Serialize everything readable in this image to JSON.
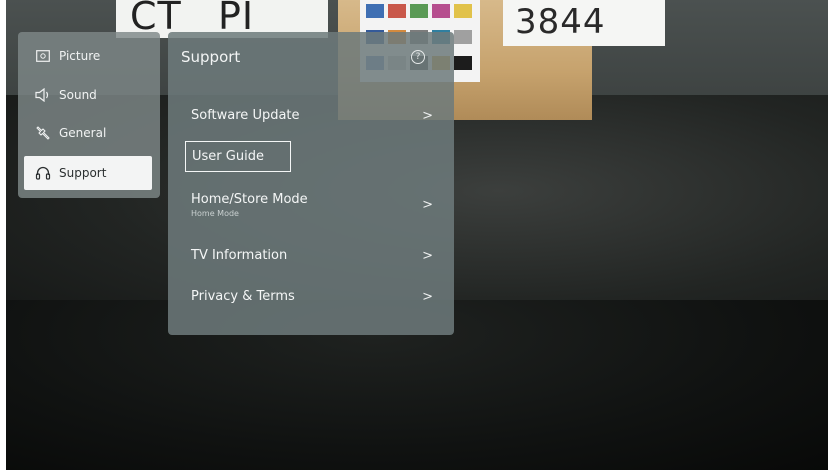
{
  "background": {
    "card_left_a": "CT",
    "card_left_b": "PI",
    "card_right": "3844",
    "swatch_colors": [
      "#3f6fb3",
      "#c9584a",
      "#5a9a55",
      "#b64e8e",
      "#e1c24a",
      "#345a9a",
      "#d48a3e",
      "#7c7c7c",
      "#2f7fa0",
      "#a0a0a0",
      "#6a8fc4",
      "#c4c4c4",
      "#4a4a4a",
      "#d6a43c",
      "#1c1c1c"
    ]
  },
  "categories": [
    {
      "label": "Picture",
      "icon": "picture-icon",
      "selected": false
    },
    {
      "label": "Sound",
      "icon": "speaker-icon",
      "selected": false
    },
    {
      "label": "General",
      "icon": "wrench-icon",
      "selected": false
    },
    {
      "label": "Support",
      "icon": "headset-icon",
      "selected": true
    }
  ],
  "panel": {
    "title": "Support",
    "help_icon_glyph": "?",
    "items": [
      {
        "label": "Software Update",
        "sub": "",
        "chevron": ">"
      },
      {
        "label": "User Guide",
        "sub": "",
        "chevron": ""
      },
      {
        "label": "Home/Store Mode",
        "sub": "Home Mode",
        "chevron": ">"
      },
      {
        "label": "TV Information",
        "sub": "",
        "chevron": ">"
      },
      {
        "label": "Privacy & Terms",
        "sub": "",
        "chevron": ">"
      }
    ]
  },
  "colors": {
    "menu_bg": "#7e8888",
    "panel_bg": "#6e7a7c",
    "selected_bg": "#f3f4f4",
    "text": "#f4f6f6"
  }
}
